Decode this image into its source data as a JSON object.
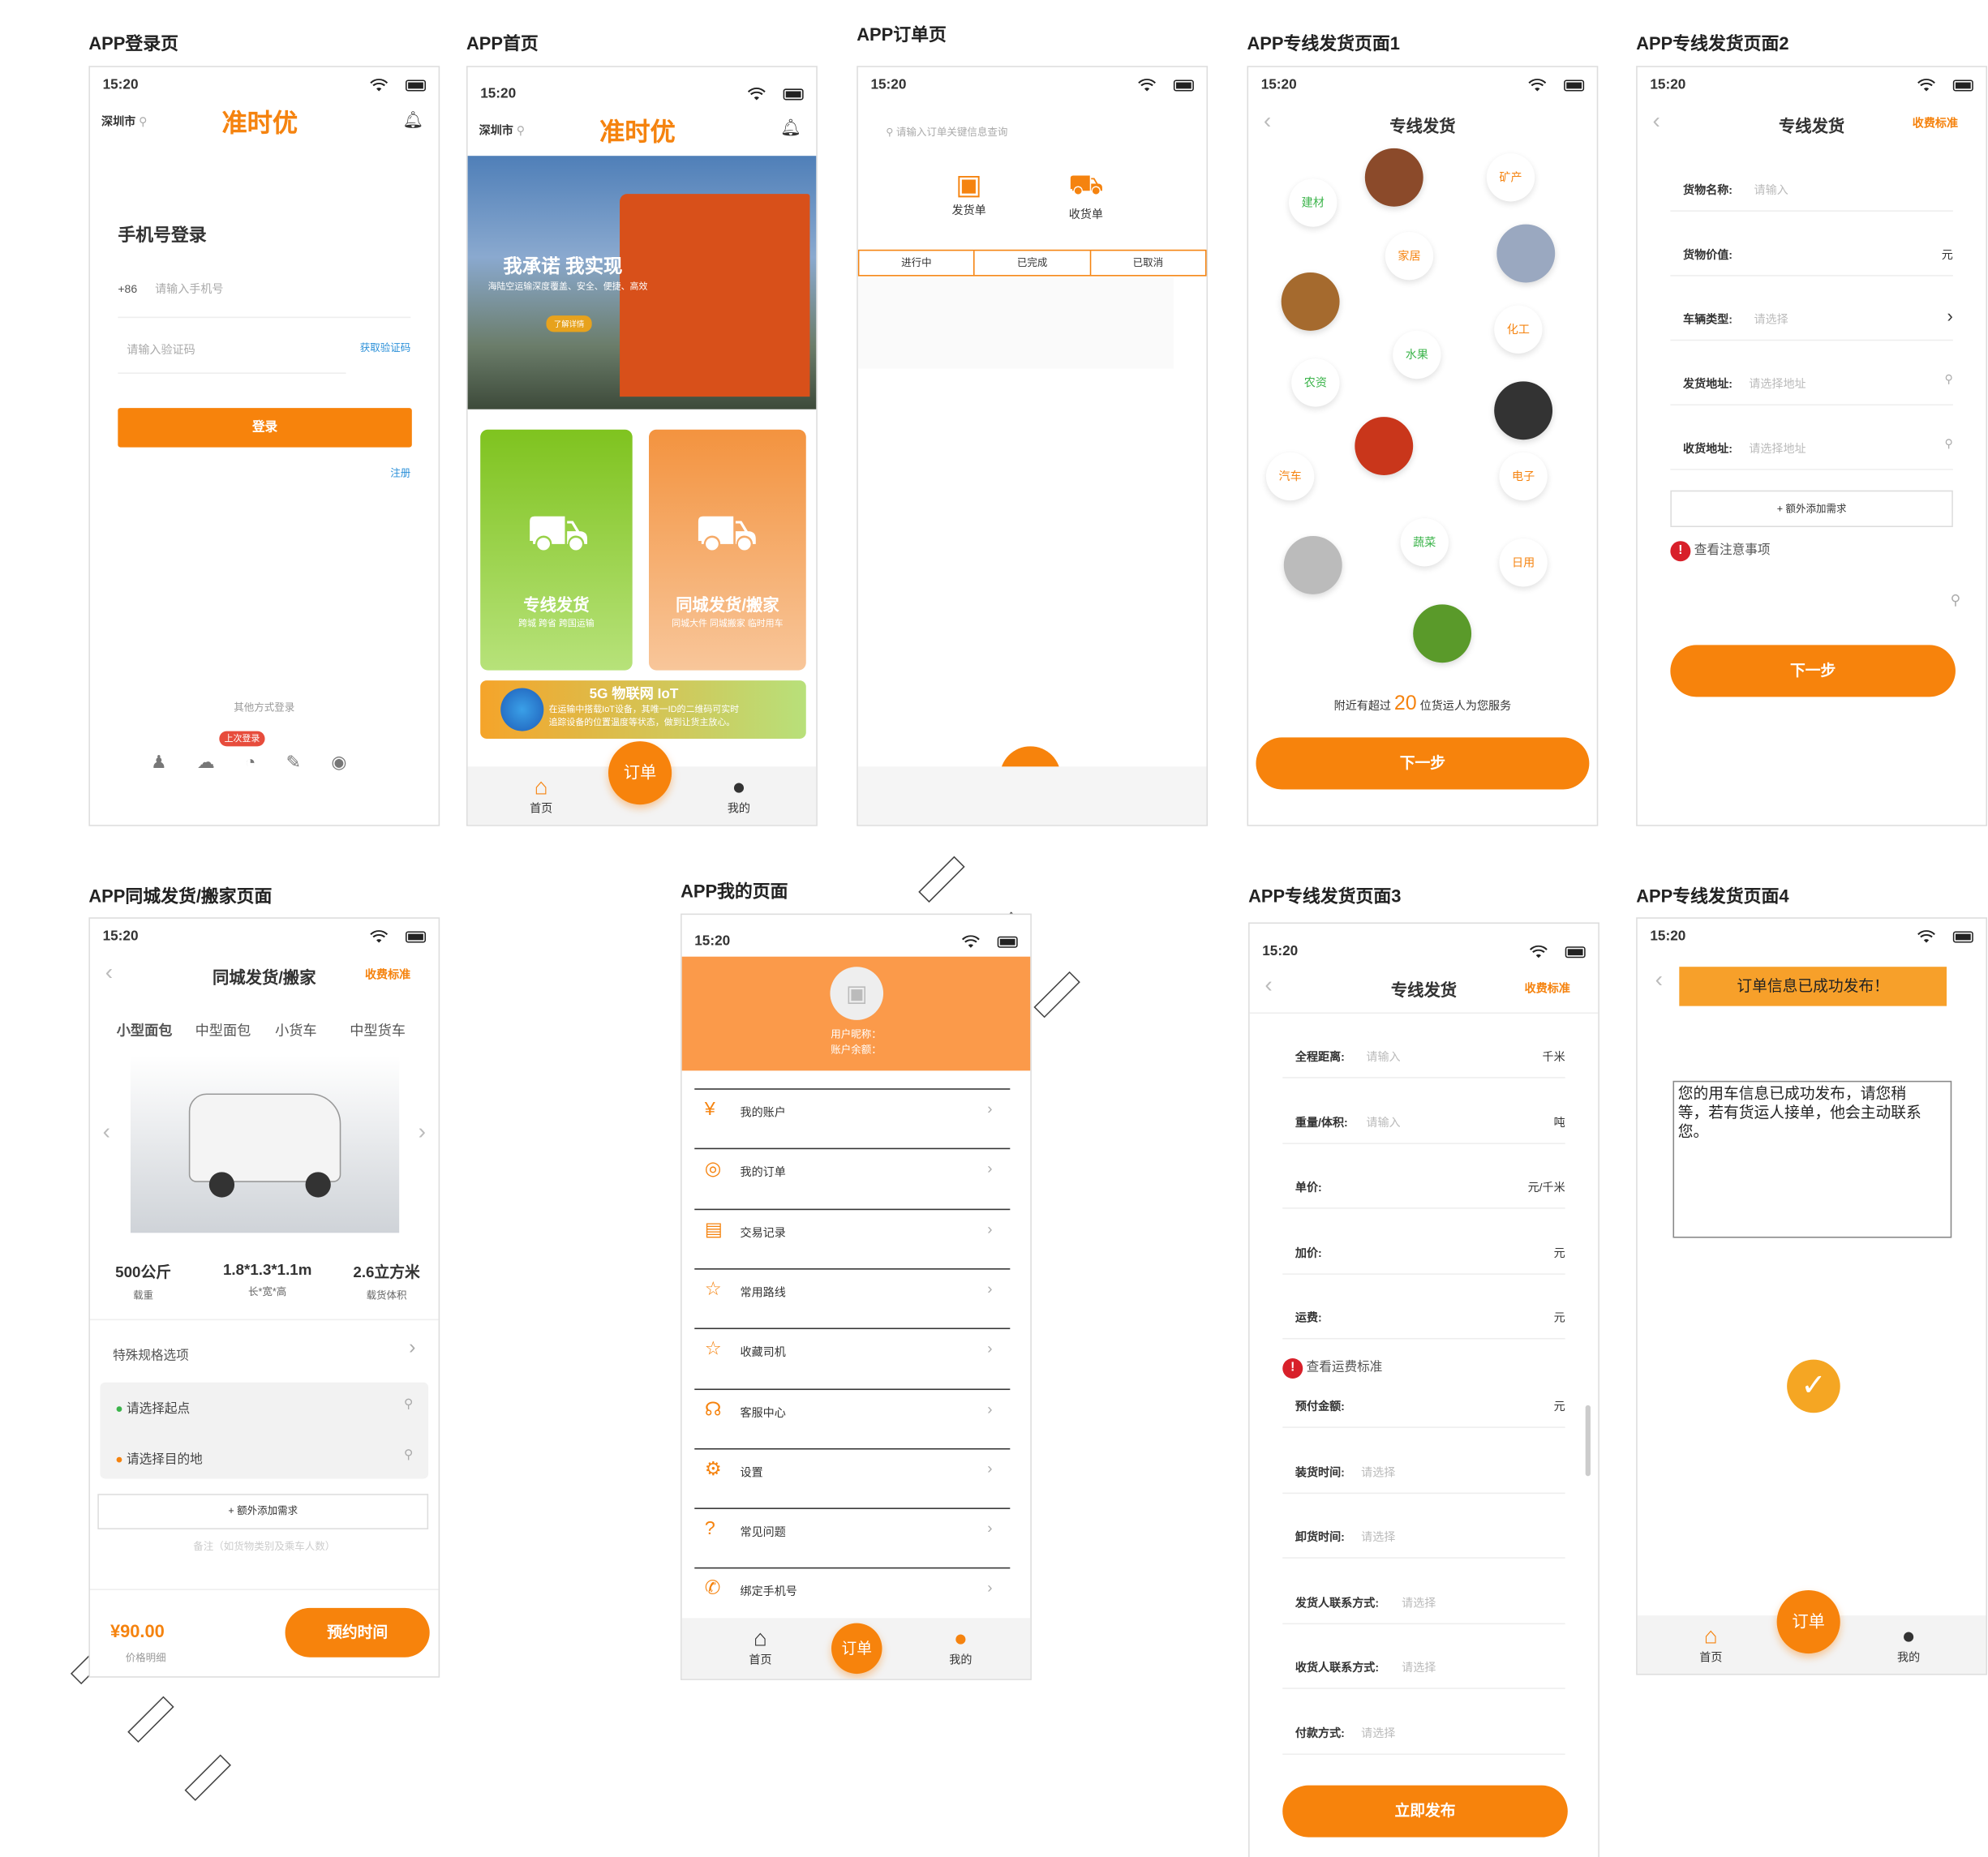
{
  "status_time": "15:20",
  "labels": {
    "login": "APP登录页",
    "home": "APP首页",
    "orders": "APP订单页",
    "line1": "APP专线发货页面1",
    "line2": "APP专线发货页面2",
    "city": "APP同城发货/搬家页面",
    "mine": "APP我的页面",
    "line3": "APP专线发货页面3",
    "line4": "APP专线发货页面4"
  },
  "brand": "准时优",
  "city": "深圳市",
  "login": {
    "title": "手机号登录",
    "code": "+86",
    "phone_placeholder": "请输入手机号",
    "sms_placeholder": "请输入验证码",
    "get_code": "获取验证码",
    "login_btn": "登录",
    "register": "注册",
    "other": "其他方式登录",
    "last": "上次登录"
  },
  "home": {
    "banner_title": "我承诺 我实现",
    "banner_sub": "海陆空运输深度覆盖、安全、便捷、高效",
    "banner_btn": "了解详情",
    "card1_title": "专线发货",
    "card1_sub": "跨城 跨省 跨国运输",
    "card2_title": "同城发货/搬家",
    "card2_sub": "同城大件 同城搬家 临时用车",
    "iot_title": "5G 物联网 IoT",
    "iot_sub1": "在运输中搭载IoT设备，其唯一ID的二维码可实时",
    "iot_sub2": "追踪设备的位置温度等状态，做到让货主放心。"
  },
  "tabs": {
    "home": "首页",
    "order": "订单",
    "mine": "我的"
  },
  "orders": {
    "search_placeholder": "请输入订单关键信息查询",
    "ship": "发货单",
    "receive": "收货单",
    "tabs": [
      "进行中",
      "已完成",
      "已取消"
    ]
  },
  "line": {
    "title": "专线发货",
    "fee": "收费标准",
    "next": "下一步",
    "nearby_pre": "附近有超过",
    "nearby_num": "20",
    "nearby_post": "位货运人为您服务",
    "cats": [
      "建材",
      "矿产",
      "家居",
      "化工",
      "水果",
      "农资",
      "汽车",
      "电子",
      "蔬菜",
      "日用"
    ]
  },
  "line2": {
    "rows": [
      {
        "k": "货物名称:",
        "v": "请输入",
        "u": ""
      },
      {
        "k": "货物价值:",
        "v": "",
        "u": "元"
      },
      {
        "k": "车辆类型:",
        "v": "请选择",
        "u": ">"
      },
      {
        "k": "发货地址:",
        "v": "请选择地址",
        "u": ""
      },
      {
        "k": "收货地址:",
        "v": "请选择地址",
        "u": ""
      }
    ],
    "extra": "+ 额外添加需求",
    "notice": "查看注意事项"
  },
  "city_page": {
    "title": "同城发货/搬家",
    "fee": "收费标准",
    "cars": [
      "小型面包",
      "中型面包",
      "小货车",
      "中型货车"
    ],
    "specs": [
      {
        "v": "500公斤",
        "l": "载重"
      },
      {
        "v": "1.8*1.3*1.1m",
        "l": "长*宽*高"
      },
      {
        "v": "2.6立方米",
        "l": "载货体积"
      }
    ],
    "special": "特殊规格选项",
    "start": "请选择起点",
    "end": "请选择目的地",
    "extra": "+ 额外添加需求",
    "remark": "备注（如货物类别及乘车人数）",
    "price": "¥90.00",
    "price_detail": "价格明细",
    "book": "预约时间"
  },
  "mine": {
    "nick": "用户昵称：",
    "balance": "账户余额：",
    "items": [
      {
        "icon": "¥",
        "label": "我的账户"
      },
      {
        "icon": "◎",
        "label": "我的订单"
      },
      {
        "icon": "▤",
        "label": "交易记录"
      },
      {
        "icon": "☆",
        "label": "常用路线"
      },
      {
        "icon": "☆",
        "label": "收藏司机"
      },
      {
        "icon": "☊",
        "label": "客服中心"
      },
      {
        "icon": "⚙",
        "label": "设置"
      },
      {
        "icon": "?",
        "label": "常见问题"
      },
      {
        "icon": "✆",
        "label": "绑定手机号"
      }
    ]
  },
  "line3": {
    "rows": [
      {
        "k": "全程距离:",
        "v": "请输入",
        "u": "千米"
      },
      {
        "k": "重量/体积:",
        "v": "请输入",
        "u": "吨"
      },
      {
        "k": "单价:",
        "v": "",
        "u": "元/千米"
      },
      {
        "k": "加价:",
        "v": "",
        "u": "元"
      },
      {
        "k": "运费:",
        "v": "",
        "u": "元"
      }
    ],
    "notice": "查看运费标准",
    "rows2": [
      {
        "k": "预付金额:",
        "v": "",
        "u": "元"
      },
      {
        "k": "装货时间:",
        "v": "请选择",
        "u": ""
      },
      {
        "k": "卸货时间:",
        "v": "请选择",
        "u": ""
      },
      {
        "k": "发货人联系方式:",
        "v": "请选择",
        "u": ""
      },
      {
        "k": "收货人联系方式:",
        "v": "请选择",
        "u": ""
      },
      {
        "k": "付款方式:",
        "v": "请选择",
        "u": ""
      }
    ],
    "publish": "立即发布"
  },
  "line4": {
    "banner": "订单信息已成功发布！",
    "msg": "您的用车信息已成功发布，请您稍等，若有货运人接单，他会主动联系您。"
  },
  "colors": {
    "accent": "#f7830c",
    "green": "#3cb44b"
  }
}
